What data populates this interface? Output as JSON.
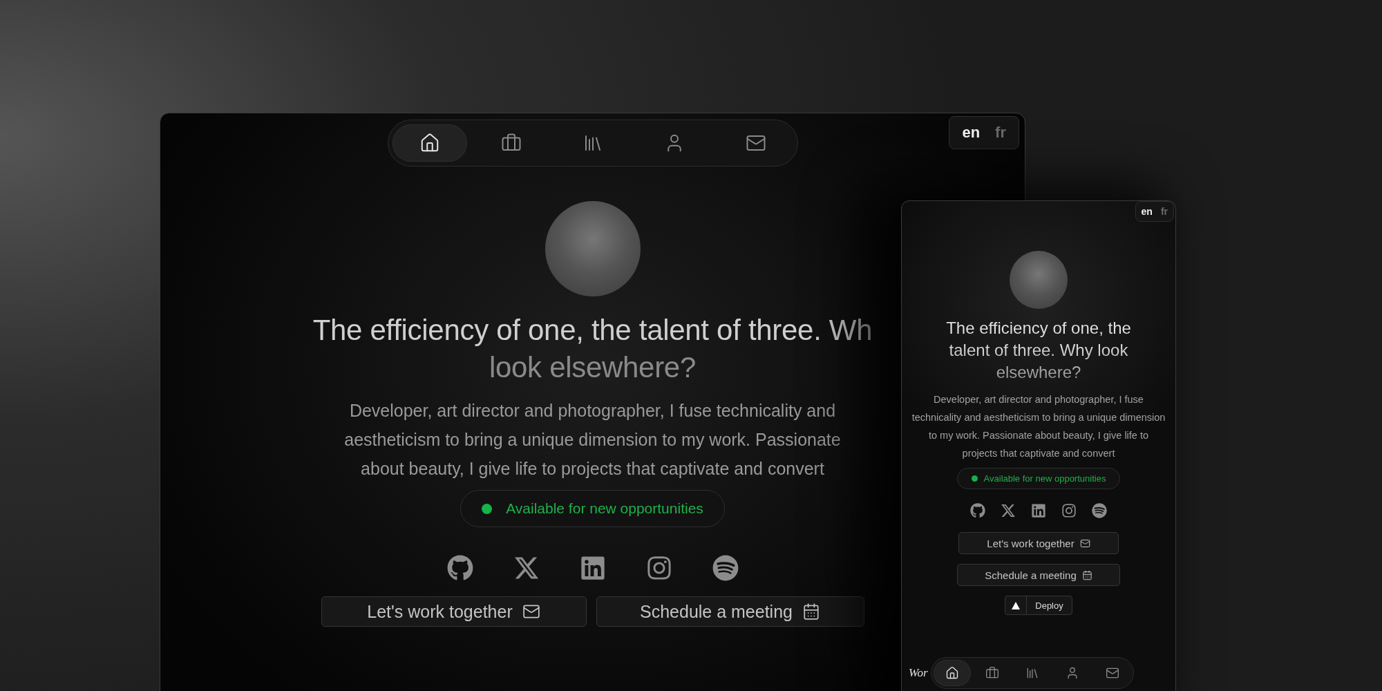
{
  "desktop": {
    "nav": [
      {
        "selected": true
      },
      {
        "selected": false
      },
      {
        "selected": false
      },
      {
        "selected": false
      },
      {
        "selected": false
      }
    ],
    "languages": [
      {
        "label": "en",
        "selected": true
      },
      {
        "label": "fr",
        "selected": false
      }
    ],
    "heading": [
      "The efficiency of one, the talent of three. Wh",
      "look elsewhere?"
    ],
    "intro": [
      "Developer, art director and photographer, I fuse technicality and",
      "aestheticism to bring a unique dimension to my work. Passionate",
      "about beauty, I give life to projects that captivate and convert"
    ],
    "status": {
      "label": "Available for new opportunities",
      "available": true
    },
    "buttons": [
      "Let's work together",
      "Schedule a meeting"
    ]
  },
  "mobile": {
    "languages": [
      {
        "label": "en",
        "selected": true
      },
      {
        "label": "fr",
        "selected": false
      }
    ],
    "heading": "The efficiency of one, the talent of three. Why look elsewhere?",
    "intro": "Developer, art director and photographer, I fuse technicality and aestheticism to bring a unique dimension to my work. Passionate about beauty, I give life to projects that captivate and convert",
    "status": {
      "label": "Available for new opportunities",
      "available": true
    },
    "buttons": [
      "Let's work together",
      "Schedule a meeting"
    ],
    "deploy": "Deploy",
    "footer_text": "Wor",
    "nav": [
      {
        "selected": true
      },
      {
        "selected": false
      },
      {
        "selected": false
      },
      {
        "selected": false
      },
      {
        "selected": false
      }
    ]
  }
}
